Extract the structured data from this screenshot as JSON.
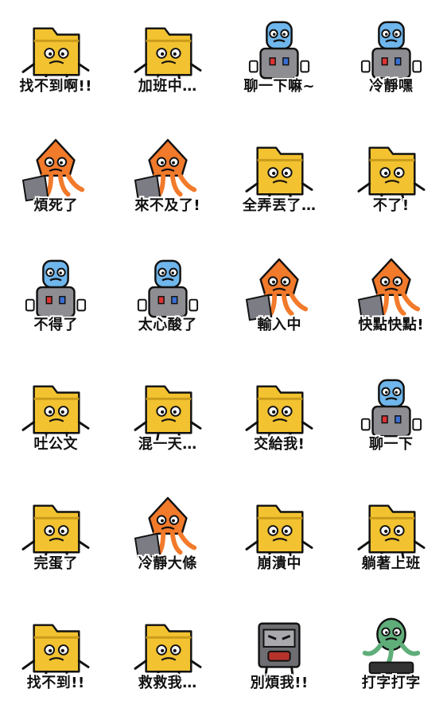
{
  "colors": {
    "folder": "#f2c230",
    "folder_dark": "#c99a1a",
    "squid": "#f27a2b",
    "cooler": "#8d8d92",
    "bottle": "#6fb6ec",
    "printer": "#6e6e72",
    "green_creature": "#5fae7a",
    "outline": "#111111",
    "red_flag": "#e2332b"
  },
  "stickers": [
    {
      "character": "folder",
      "label": "找不到啊!!"
    },
    {
      "character": "folder",
      "label": "加班中…"
    },
    {
      "character": "water-cooler",
      "label": "聊一下嘛~"
    },
    {
      "character": "water-cooler",
      "label": "冷靜嘿"
    },
    {
      "character": "squid",
      "label": "煩死了"
    },
    {
      "character": "squid",
      "label": "來不及了!"
    },
    {
      "character": "folder",
      "label": "全弄丟了…"
    },
    {
      "character": "folder",
      "label": "不了!"
    },
    {
      "character": "water-cooler",
      "label": "不得了"
    },
    {
      "character": "water-cooler",
      "label": "太心酸了"
    },
    {
      "character": "squid",
      "label": "輸入中"
    },
    {
      "character": "squid",
      "label": "快點快點!"
    },
    {
      "character": "folder",
      "label": "吐公文"
    },
    {
      "character": "folder",
      "label": "混一天…"
    },
    {
      "character": "folder",
      "label": "交給我!"
    },
    {
      "character": "water-cooler",
      "label": "聊一下"
    },
    {
      "character": "folder",
      "label": "完蛋了"
    },
    {
      "character": "squid",
      "label": "冷靜大條"
    },
    {
      "character": "folder",
      "label": "崩潰中"
    },
    {
      "character": "folder",
      "label": "躺著上班"
    },
    {
      "character": "folder",
      "label": "找不到!!"
    },
    {
      "character": "folder",
      "label": "救救我…"
    },
    {
      "character": "printer",
      "label": "別煩我!!"
    },
    {
      "character": "green-creature",
      "label": "打字打字"
    }
  ]
}
